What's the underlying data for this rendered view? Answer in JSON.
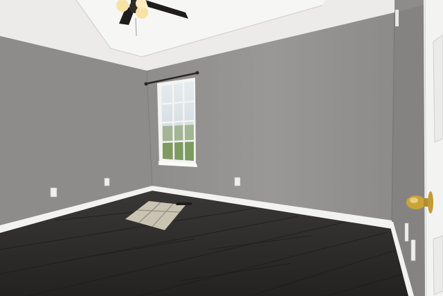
{
  "scene": {
    "colors": {
      "ceiling": "#efefee",
      "ceiling_tray": "#f6f6f5",
      "wall_left": "#8f8d8b",
      "wall_back": "#999795",
      "wall_right": "#858381",
      "baseboard": "#f2f2f1",
      "floor": "#2b2a29",
      "floor_plank_line": "#1d1c1b",
      "window_frame": "#f4f4f3",
      "window_sky": "#dfe7ea",
      "window_grass": "#7f9b62",
      "door": "#f3f3f2",
      "door_knob": "#c9a338",
      "curtain_rod": "#2a2624",
      "fan_blade": "#1f1d1c",
      "fan_light": "#f7e3a4",
      "sunlight": "#e9e2cf",
      "outlet": "#eeeeec"
    },
    "icons": [
      "ceiling-fan-icon",
      "window-icon",
      "door-knob-icon",
      "outlet-icon"
    ]
  }
}
